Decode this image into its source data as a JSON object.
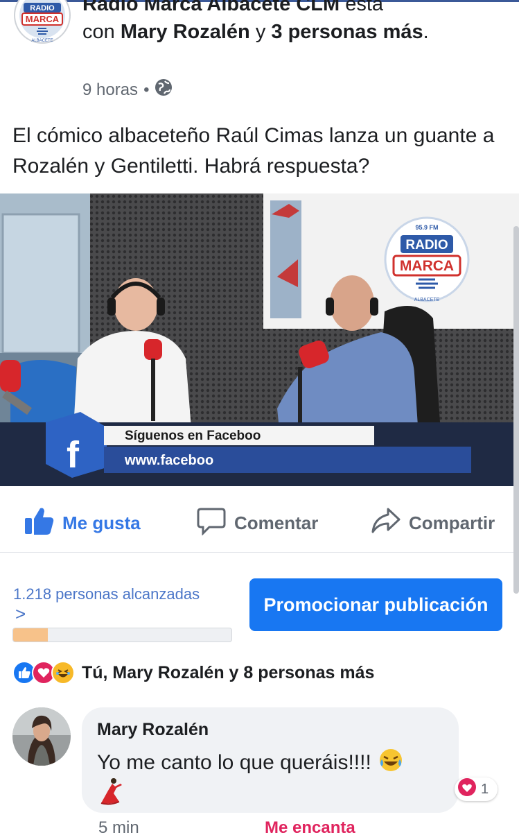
{
  "header": {
    "page_name": "Radio Marca Albacete CLM",
    "verb": "está",
    "with_text": "con",
    "tagged_person": "Mary Rozalén",
    "conj": "y",
    "others": "3 personas más",
    "period": ".",
    "time": "9 horas",
    "separator": "•",
    "privacy_icon": "globe-icon"
  },
  "post": {
    "text": "El cómico albaceteño Raúl Cimas lanza un guante a Rozalén y Gentiletti. Habrá respuesta?"
  },
  "video": {
    "lower_third_line1": "Síguenos en Faceboo",
    "lower_third_line2": "www.faceboo",
    "logo_freq": "95.9 FM",
    "logo_line1": "RADIO",
    "logo_line2": "MARCA",
    "logo_sub": "ALBACETE"
  },
  "avatar_logo": {
    "line1": "RADIO",
    "line2": "MARCA",
    "sub": "ALBACETE"
  },
  "actions": {
    "like_label": "Me gusta",
    "comment_label": "Comentar",
    "share_label": "Compartir"
  },
  "reach": {
    "text": "1.218 personas alcanzadas",
    "chevron": ">",
    "progress_fraction": 0.16,
    "promote_label": "Promocionar publicación"
  },
  "reactions": {
    "summary": "Tú, Mary Rozalén y 8 personas más",
    "icons": [
      "like-icon",
      "love-icon",
      "haha-icon"
    ]
  },
  "comment": {
    "author": "Mary Rozalén",
    "text": "Yo me canto lo que queráis!!!!",
    "reaction_count": "1",
    "time": "5 min",
    "reaction_label": "Me encanta"
  },
  "colors": {
    "accent": "#1877f2",
    "link_blue": "#3578e5",
    "love_red": "#e0245e",
    "progress": "#f7c28a"
  }
}
